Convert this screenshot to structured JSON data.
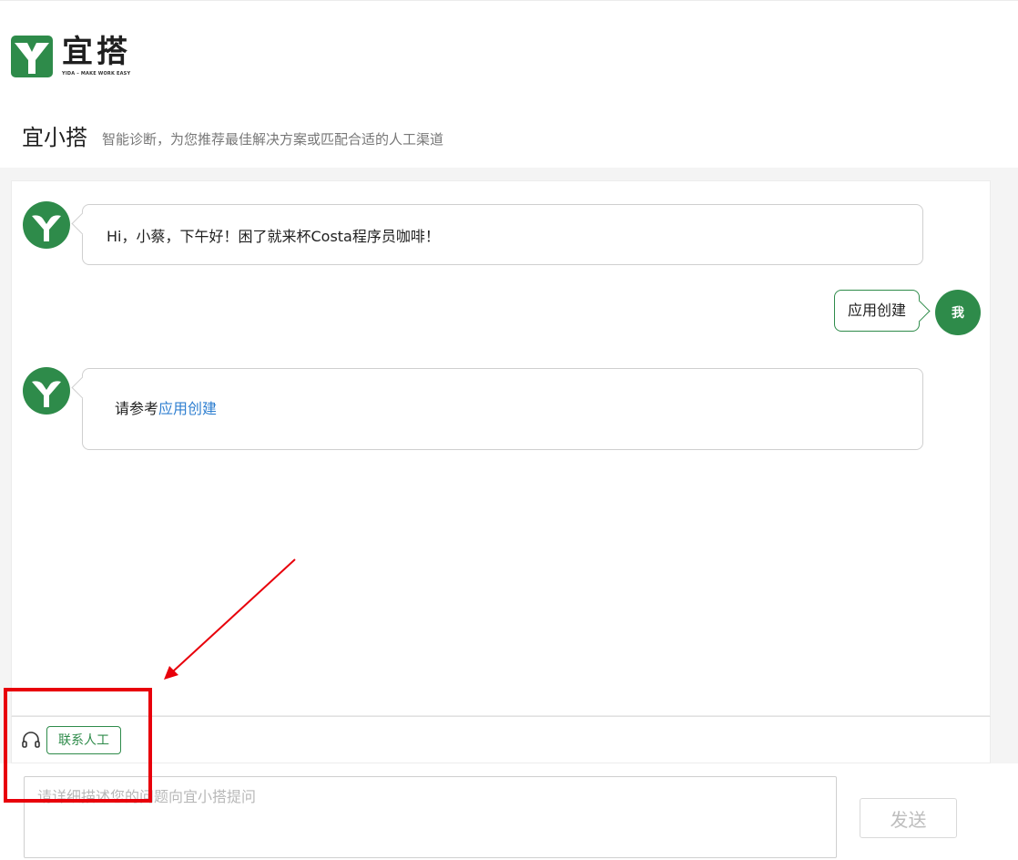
{
  "brand": {
    "logo_text": "宜搭",
    "tagline": "YIDA – MAKE WORK EASY",
    "brand_color": "#2e8b4a"
  },
  "header": {
    "title": "宜小搭",
    "subtitle": "智能诊断，为您推荐最佳解决方案或匹配合适的人工渠道"
  },
  "chat": {
    "messages": [
      {
        "from": "bot",
        "text": "Hi，小蔡，下午好！困了就来杯Costa程序员咖啡！"
      },
      {
        "from": "user",
        "text": "应用创建",
        "avatar_label": "我"
      },
      {
        "from": "bot",
        "prefix": "请参考",
        "link_text": "应用创建",
        "link_color": "#2f7fd0"
      }
    ]
  },
  "toolbar": {
    "headset_icon": "headset-icon",
    "contact_label": "联系人工"
  },
  "composer": {
    "placeholder": "请详细描述您的问题向宜小搭提问",
    "send_label": "发送"
  },
  "annotation": {
    "color": "#e8000b",
    "shapes": [
      "arrow",
      "rectangle"
    ]
  }
}
